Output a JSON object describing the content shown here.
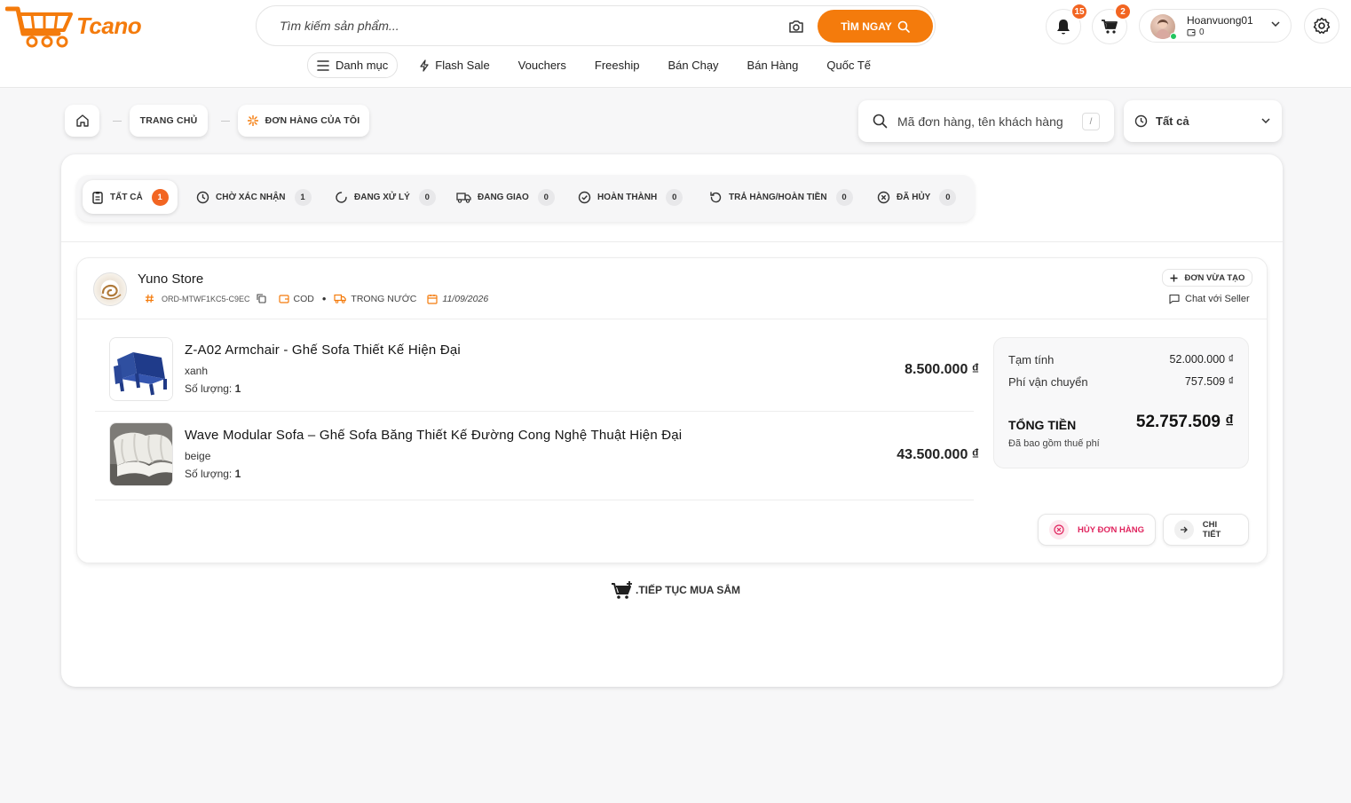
{
  "brand": {
    "name": "Tcano",
    "accent": "#f47b0c",
    "badge": "#f26522"
  },
  "header": {
    "search_placeholder": "Tìm kiếm sản phẩm...",
    "search_button": "TÌM NGAY",
    "notifications_count": "15",
    "cart_count": "2",
    "user": {
      "name": "Hoanvuong01",
      "balance": "0"
    },
    "nav": [
      {
        "label": "Danh mục",
        "icon": "menu-icon"
      },
      {
        "label": "Flash Sale",
        "icon": "lightning-icon"
      },
      {
        "label": "Vouchers"
      },
      {
        "label": "Freeship"
      },
      {
        "label": "Bán Chạy"
      },
      {
        "label": "Bán Hàng"
      },
      {
        "label": "Quốc Tế"
      }
    ]
  },
  "breadcrumb": {
    "home": "TRANG CHỦ",
    "current": "ĐƠN HÀNG CỦA TÔI"
  },
  "order_search": {
    "placeholder": "Mã đơn hàng, tên khách hàng",
    "shortcut": "/"
  },
  "filter": {
    "selected": "Tất cả"
  },
  "tabs": [
    {
      "label": "TẤT CẢ",
      "count": "1",
      "active": true
    },
    {
      "label": "CHỜ XÁC NHẬN",
      "count": "1"
    },
    {
      "label": "ĐANG XỬ LÝ",
      "count": "0"
    },
    {
      "label": "ĐANG GIAO",
      "count": "0"
    },
    {
      "label": "HOÀN THÀNH",
      "count": "0"
    },
    {
      "label": "TRẢ HÀNG/HOÀN TIỀN",
      "count": "0"
    },
    {
      "label": "ĐÃ HỦY",
      "count": "0"
    }
  ],
  "order": {
    "store": "Yuno Store",
    "id": "ORD-MTWF1KC5-C9EC",
    "payment": "COD",
    "shipping": "TRONG NƯỚC",
    "date": "11/09/2026",
    "status_button": "ĐƠN VỪA TẠO",
    "chat": "Chat với Seller",
    "items": [
      {
        "name": "Z-A02 Armchair - Ghế Sofa Thiết Kế Hiện Đại",
        "variant": "xanh",
        "qty_label": "Số lượng:",
        "qty": "1",
        "price": "8.500.000 ₫"
      },
      {
        "name": "Wave Modular Sofa – Ghế Sofa Băng Thiết Kế Đường Cong Nghệ Thuật Hiện Đại",
        "variant": "beige",
        "qty_label": "Số lượng:",
        "qty": "1",
        "price": "43.500.000 ₫"
      }
    ],
    "summary": {
      "subtotal_label": "Tạm tính",
      "subtotal": "52.000.000 ₫",
      "shipping_label": "Phí vận chuyển",
      "shipping_fee": "757.509 ₫",
      "total_label": "TỔNG TIỀN",
      "total": "52.757.509 ₫",
      "note": "Đã bao gồm thuế phí"
    },
    "cancel_button": "HỦY ĐƠN HÀNG",
    "detail_button": "CHI TIẾT"
  },
  "continue_shopping": ".TIẾP TỤC MUA SẮM"
}
